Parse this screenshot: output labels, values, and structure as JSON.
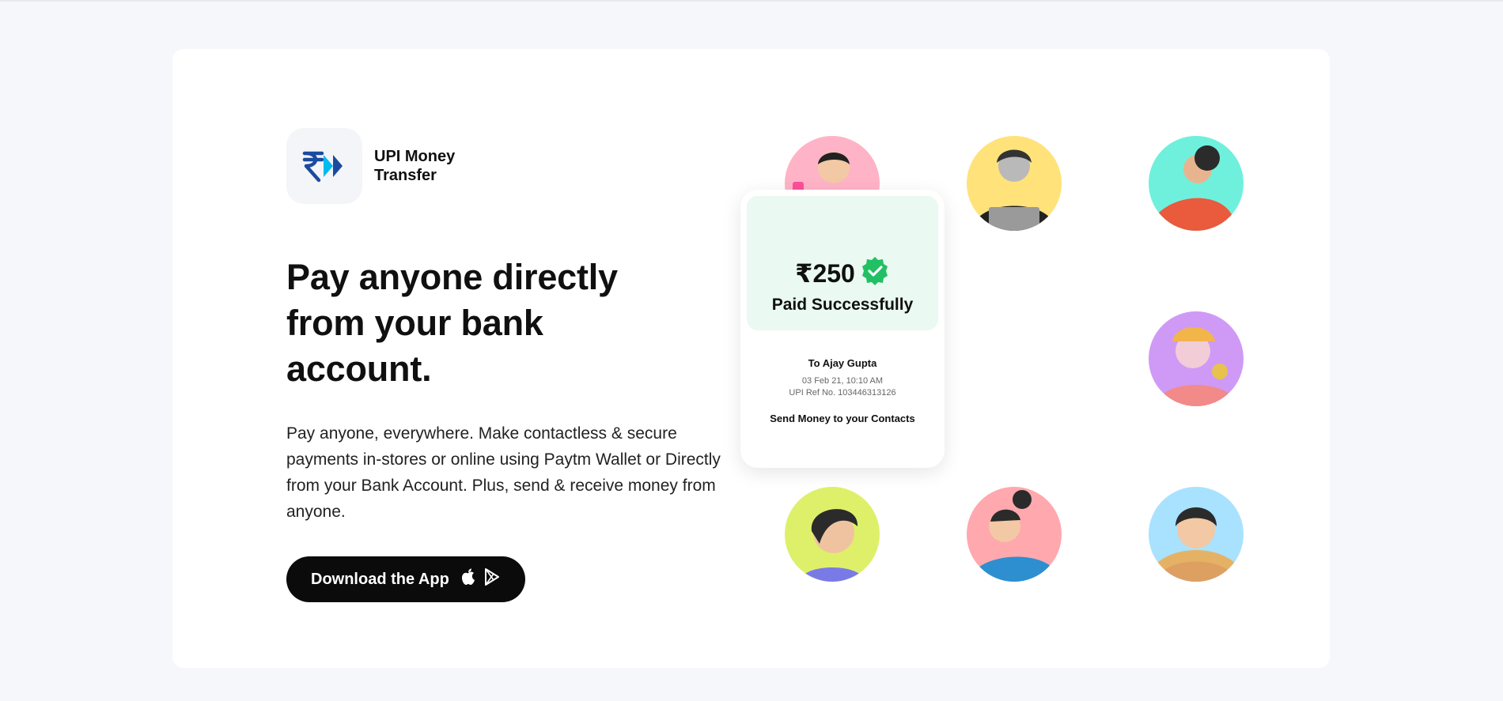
{
  "product": {
    "name": "UPI Money Transfer",
    "icon": "rupee-arrow-icon"
  },
  "hero": {
    "headline": "Pay anyone directly from your bank account.",
    "description": "Pay anyone, everywhere. Make contactless & secure payments in-stores or online using Paytm Wallet or Directly from your Bank Account. Plus, send & receive money from anyone.",
    "cta_label": "Download the App",
    "cta_icons": [
      "apple-icon",
      "play-store-icon"
    ]
  },
  "receipt": {
    "amount": "₹250",
    "status": "Paid Successfully",
    "recipient": "To Ajay Gupta",
    "datetime": "03 Feb 21, 10:10 AM",
    "ref": "UPI Ref No. 103446313126",
    "footer": "Send Money to your Contacts",
    "status_icon": "verified-check-icon"
  },
  "colors": {
    "accent_dark": "#0b0b0b",
    "paytm_blue": "#1a4ba0",
    "paytm_light_blue": "#00baf2",
    "success_green": "#21c064",
    "success_bg": "#eaf9f1"
  },
  "avatars": [
    {
      "bg": "#ffb3c7",
      "shirt": "#6c63e6"
    },
    {
      "bg": "#ffe27a",
      "shirt": "#222222"
    },
    {
      "bg": "#6ff0dc",
      "shirt": "#ea5a3c"
    },
    {
      "bg": "#a6f5a6",
      "shirt": "#ea5a3c"
    },
    {
      "bg": "#cf9af5",
      "shirt": "#f28a8a"
    },
    {
      "bg": "#def06a",
      "shirt": "#7a7ae6"
    },
    {
      "bg": "#ffa8ae",
      "shirt": "#2d8fd0"
    },
    {
      "bg": "#a8e2ff",
      "shirt": "#7b6fe2"
    }
  ]
}
